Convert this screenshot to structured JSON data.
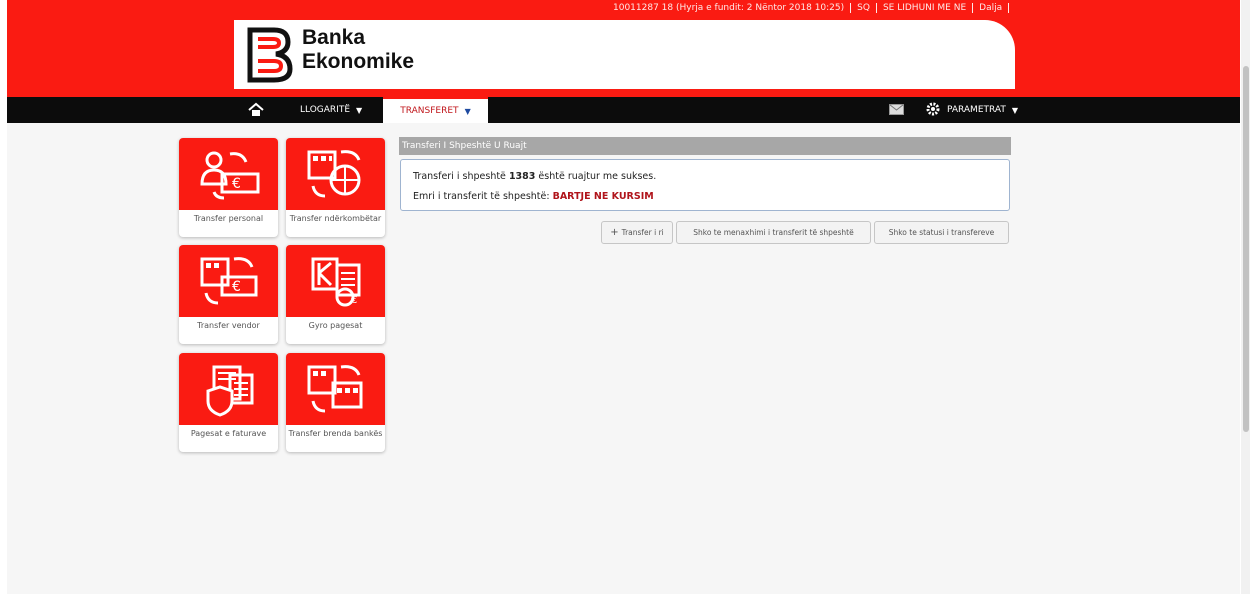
{
  "colors": {
    "brand_red": "#fa1b12",
    "nav_black": "#0c0c0c",
    "accent_red_text": "#b0141b"
  },
  "topbar": {
    "items": [
      "10011287 18 (Hyrja e fundit: 2 Nëntor 2018 10:25)",
      "SQ",
      "SE LIDHUNI ME NE",
      "Dalja"
    ]
  },
  "logo": {
    "line1": "Banka",
    "line2": "Ekonomike"
  },
  "nav": {
    "home_icon": "home-icon",
    "accounts_label": "LLOGARITË",
    "transfers_label": "TRANSFERET",
    "mail_icon": "mail-icon",
    "settings_icon": "gear-icon",
    "params_label": "PARAMETRAT"
  },
  "tiles": [
    {
      "label": "Transfer personal",
      "icon": "personal-transfer-icon"
    },
    {
      "label": "Transfer ndërkombëtar",
      "icon": "international-transfer-icon"
    },
    {
      "label": "Transfer vendor",
      "icon": "domestic-transfer-icon"
    },
    {
      "label": "Gyro pagesat",
      "icon": "giro-payment-icon"
    },
    {
      "label": "Pagesat e faturave",
      "icon": "bill-payment-icon"
    },
    {
      "label": "Transfer brenda bankës",
      "icon": "internal-transfer-icon"
    }
  ],
  "panel": {
    "title": "Transferi I Shpeshtë U Ruajt",
    "msg_prefix": "Transferi i shpeshtë",
    "transfer_id": "1383",
    "msg_suffix": "është ruajtur me sukses.",
    "name_label": "Emri i transferit të shpeshtë:",
    "name_value": "BARTJE NE KURSIM"
  },
  "buttons": {
    "new_transfer": "Transfer i ri",
    "manage": "Shko te menaxhimi i transferit të shpeshtë",
    "status": "Shko te statusi i transfereve"
  }
}
